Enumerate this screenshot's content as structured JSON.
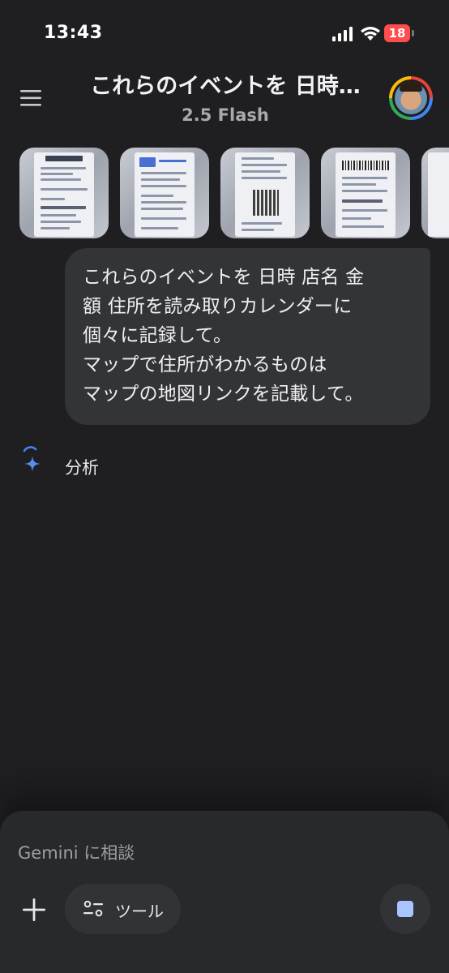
{
  "status_bar": {
    "time": "13:43",
    "battery_level": "18",
    "signal_icon": "cellular-signal-icon",
    "wifi_icon": "wifi-icon"
  },
  "header": {
    "menu_icon": "hamburger-menu-icon",
    "title": "これらのイベントを 日時…",
    "model": "2.5 Flash"
  },
  "attachments": [
    {
      "icon": "receipt-image-icon"
    },
    {
      "icon": "receipt-image-icon"
    },
    {
      "icon": "receipt-image-icon"
    },
    {
      "icon": "receipt-image-icon"
    },
    {
      "icon": "receipt-image-icon"
    }
  ],
  "user_message": {
    "lines": [
      "これらのイベントを 日時 店名 金",
      "額 住所を読み取りカレンダーに",
      "個々に記録して。",
      "マップで住所がわかるものは",
      "マップの地図リンクを記載して。"
    ]
  },
  "response": {
    "status_label": "分析",
    "icon": "gemini-spark-icon"
  },
  "composer": {
    "placeholder": "Gemini に相談",
    "add_icon": "plus-icon",
    "tools_label": "ツール",
    "tools_icon": "tools-sliders-icon",
    "stop_icon": "stop-icon"
  },
  "colors": {
    "background": "#1f1f21",
    "bubble": "#333436",
    "composer": "#28292b",
    "accent_blue": "#4285f4",
    "battery_red": "#ff4d4d"
  }
}
